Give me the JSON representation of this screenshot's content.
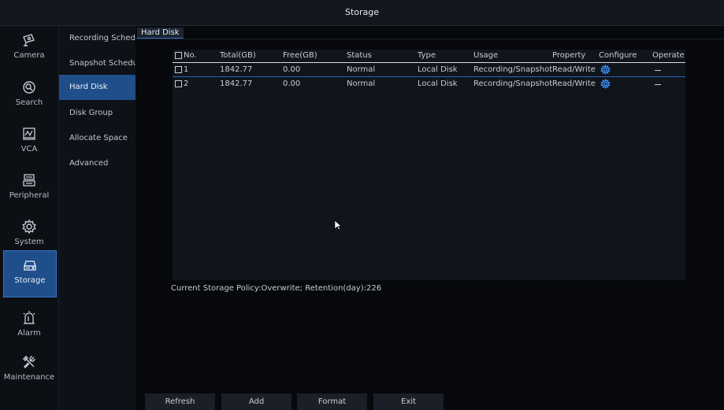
{
  "window": {
    "title": "Storage"
  },
  "left_nav": [
    {
      "label": "Camera",
      "icon": "camera-icon"
    },
    {
      "label": "Search",
      "icon": "search-icon"
    },
    {
      "label": "VCA",
      "icon": "vca-icon"
    },
    {
      "label": "Peripheral",
      "icon": "peripheral-icon"
    },
    {
      "label": "System",
      "icon": "gear-icon"
    },
    {
      "label": "Storage",
      "icon": "storage-icon",
      "active": true
    },
    {
      "label": "Alarm",
      "icon": "alarm-icon"
    },
    {
      "label": "Maintenance",
      "icon": "tools-icon"
    }
  ],
  "sub_nav": [
    {
      "label": "Recording Sched..."
    },
    {
      "label": "Snapshot Schedu.."
    },
    {
      "label": "Hard Disk",
      "active": true
    },
    {
      "label": "Disk Group"
    },
    {
      "label": "Allocate Space"
    },
    {
      "label": "Advanced"
    }
  ],
  "tab": {
    "label": "Hard Disk"
  },
  "table": {
    "columns": [
      "No.",
      "Total(GB)",
      "Free(GB)",
      "Status",
      "Type",
      "Usage",
      "Property",
      "Configure",
      "Operate"
    ],
    "rows": [
      {
        "no": "1",
        "total": "1842.77",
        "free": "0.00",
        "status": "Normal",
        "type": "Local Disk",
        "usage": "Recording/Snapshot",
        "property": "Read/Write",
        "configure_icon": "gear-icon",
        "operate": "minus-icon"
      },
      {
        "no": "2",
        "total": "1842.77",
        "free": "0.00",
        "status": "Normal",
        "type": "Local Disk",
        "usage": "Recording/Snapshot",
        "property": "Read/Write",
        "configure_icon": "gear-icon",
        "operate": "minus-icon"
      }
    ]
  },
  "policy_text": "Current Storage Policy:Overwrite; Retention(day):226",
  "buttons": {
    "refresh": "Refresh",
    "add": "Add",
    "format": "Format",
    "exit": "Exit"
  },
  "colors": {
    "accent": "#1f4e8a",
    "gear": "#3d8bf0"
  }
}
